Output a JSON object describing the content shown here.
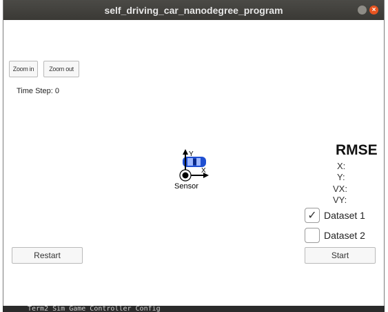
{
  "window": {
    "title": "self_driving_car_nanodegree_program",
    "close_glyph": "×"
  },
  "toolbar": {
    "zoom_in_label": "Zoom in",
    "zoom_out_label": "Zoom out"
  },
  "status": {
    "time_step_label": "Time Step: 0"
  },
  "scene": {
    "y_axis_label": "Y",
    "x_axis_label": "X",
    "sensor_label": "Sensor",
    "car_color": "#1f4fd1"
  },
  "rmse": {
    "title": "RMSE",
    "x": "X:",
    "y": "Y:",
    "vx": "VX:",
    "vy": "VY:"
  },
  "datasets": {
    "dataset1_label": "Dataset 1",
    "dataset1_checked": true,
    "dataset2_label": "Dataset 2",
    "dataset2_checked": false,
    "check_glyph": "✓"
  },
  "actions": {
    "restart_label": "Restart",
    "start_label": "Start"
  },
  "background_terminal": {
    "text": "Term2 Sim Game Controller Config"
  }
}
